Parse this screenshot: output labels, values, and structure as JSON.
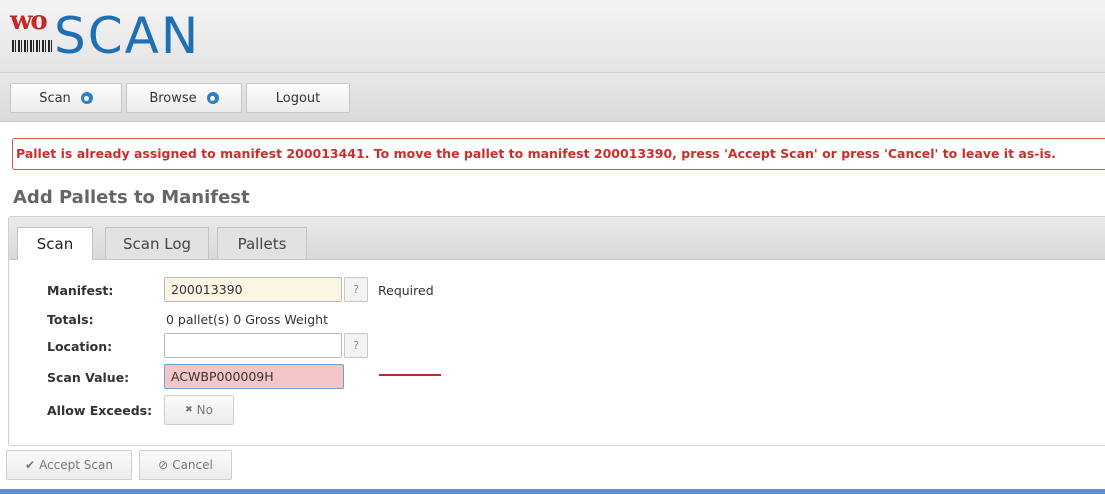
{
  "logo": {
    "prefix": "wo",
    "name": "SCAN"
  },
  "nav": {
    "items": [
      {
        "label": "Scan"
      },
      {
        "label": "Browse"
      },
      {
        "label": "Logout"
      }
    ]
  },
  "alert": {
    "message": "Pallet is already assigned to manifest 200013441. To move the pallet to manifest 200013390, press 'Accept Scan' or press 'Cancel' to leave it as-is."
  },
  "page": {
    "title": "Add Pallets to Manifest"
  },
  "tabs": [
    {
      "label": "Scan",
      "active": true
    },
    {
      "label": "Scan Log",
      "active": false
    },
    {
      "label": "Pallets",
      "active": false
    }
  ],
  "form": {
    "manifest": {
      "label": "Manifest:",
      "value": "200013390",
      "help": "?",
      "note": "Required"
    },
    "totals": {
      "label": "Totals:",
      "value": "0 pallet(s) 0 Gross Weight"
    },
    "location": {
      "label": "Location:",
      "value": "",
      "help": "?"
    },
    "scan_value": {
      "label": "Scan Value:",
      "value": "ACWBP000009H"
    },
    "allow_exceeds": {
      "label": "Allow Exceeds:",
      "icon": "✖",
      "value": "No"
    }
  },
  "actions": {
    "accept": {
      "icon": "✔",
      "label": "Accept Scan"
    },
    "cancel": {
      "icon": "⊘",
      "label": "Cancel"
    }
  },
  "colors": {
    "brand_red": "#c62828",
    "brand_blue": "#1f6fb4",
    "alert_text": "#c9302c",
    "manifest_bg": "#fdf5e4",
    "scan_bg": "#f6c6c6"
  }
}
